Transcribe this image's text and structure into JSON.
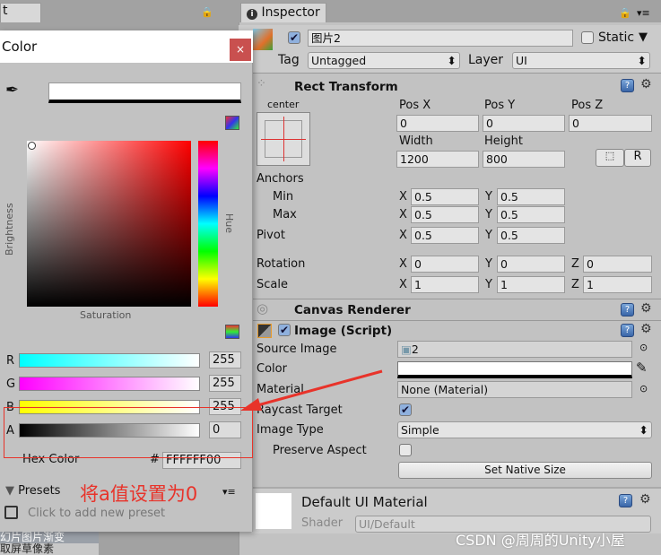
{
  "left_tab": {
    "label": "t"
  },
  "color_window": {
    "title": "Color",
    "close": "×",
    "brightness": "Brightness",
    "hue": "Hue",
    "saturation": "Saturation",
    "channels": [
      {
        "label": "R",
        "value": "255"
      },
      {
        "label": "G",
        "value": "255"
      },
      {
        "label": "B",
        "value": "255"
      },
      {
        "label": "A",
        "value": "0"
      }
    ],
    "hex_label": "Hex Color",
    "hex_hash": "#",
    "hex_value": "FFFFFF00",
    "presets": "Presets",
    "add_preset": "Click to add new preset",
    "annotation": "将a值设置为0",
    "annotation_color": "#e8332a"
  },
  "behind_list": [
    "幻片图片渐变",
    "取屏草像素"
  ],
  "inspector": {
    "tab": "Inspector",
    "name": "图片2",
    "static": "Static",
    "tag_label": "Tag",
    "tag": "Untagged",
    "layer_label": "Layer",
    "layer": "UI",
    "rect": {
      "title": "Rect Transform",
      "anchor": "center",
      "posx": "Pos X",
      "posy": "Pos Y",
      "posz": "Pos Z",
      "px": "0",
      "py": "0",
      "pz": "0",
      "width_l": "Width",
      "height_l": "Height",
      "w": "1200",
      "h": "800",
      "r_btn": "R",
      "anchors": "Anchors",
      "min": "Min",
      "max": "Max",
      "pivot": "Pivot",
      "rotation": "Rotation",
      "scale": "Scale",
      "min_x": "0.5",
      "min_y": "0.5",
      "max_x": "0.5",
      "max_y": "0.5",
      "pivot_x": "0.5",
      "pivot_y": "0.5",
      "rot_x": "0",
      "rot_y": "0",
      "rot_z": "0",
      "sc_x": "1",
      "sc_y": "1",
      "sc_z": "1",
      "X": "X",
      "Y": "Y",
      "Z": "Z"
    },
    "canvas_renderer": "Canvas Renderer",
    "image": {
      "title": "Image (Script)",
      "source_l": "Source Image",
      "source": "2",
      "color_l": "Color",
      "material_l": "Material",
      "material": "None (Material)",
      "raycast_l": "Raycast Target",
      "type_l": "Image Type",
      "type": "Simple",
      "preserve_l": "Preserve Aspect",
      "native": "Set Native Size"
    },
    "material": {
      "title": "Default UI Material",
      "shader_l": "Shader",
      "shader": "UI/Default"
    }
  },
  "watermark": "CSDN @周周的Unity小屋"
}
